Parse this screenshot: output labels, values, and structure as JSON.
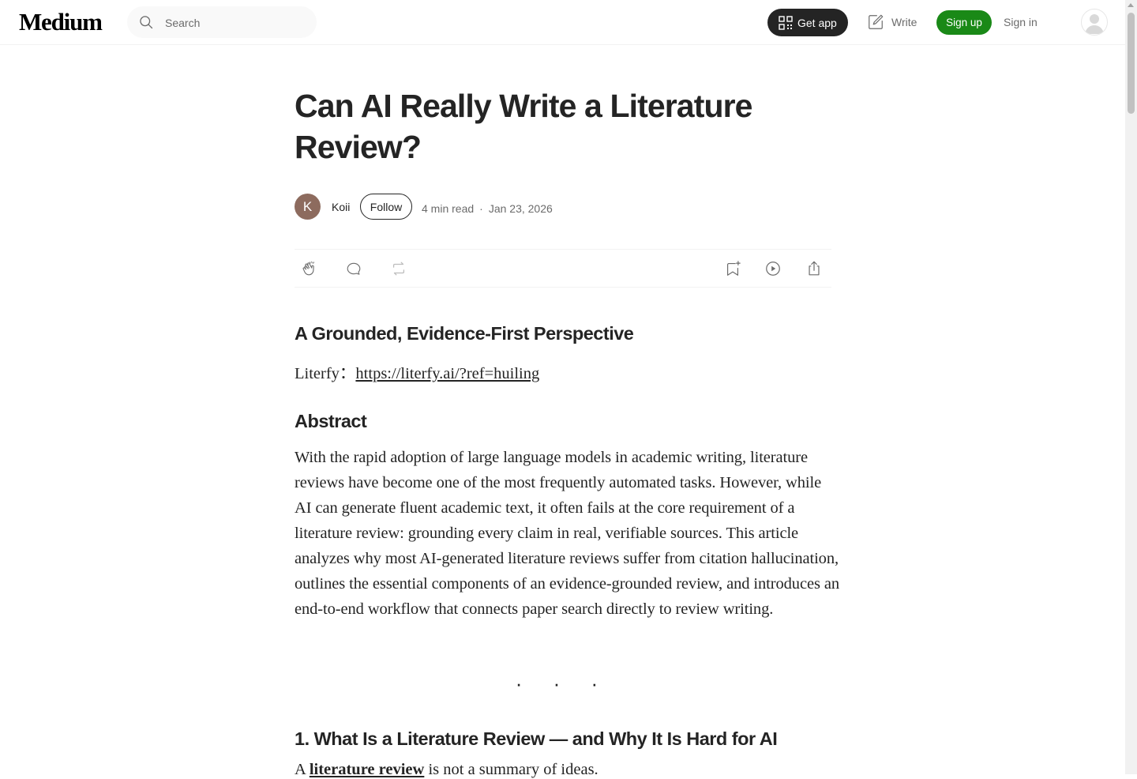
{
  "nav": {
    "logo": "Medium",
    "search_placeholder": "Search",
    "get_app": "Get app",
    "write": "Write",
    "sign_up": "Sign up",
    "sign_in": "Sign in"
  },
  "article": {
    "title": "Can AI Really Write a Literature Review?",
    "author_initial": "K",
    "author": "Koii",
    "follow": "Follow",
    "read_time": "4 min read",
    "date": "Jan 23, 2026",
    "subtitle": "A Grounded, Evidence-First Perspective",
    "ref_label": "Literfy：",
    "ref_link": "https://literfy.ai/?ref=huiling",
    "abstract_heading": "Abstract",
    "abstract_text": "With the rapid adoption of large language models in academic writing, literature reviews have become one of the most frequently automated tasks. However, while AI can generate fluent academic text, it often fails at the core requirement of a literature review: grounding every claim in real, verifiable sources. This article analyzes why most AI-generated literature reviews suffer from citation hallucination, outlines the essential components of an evidence-grounded review, and introduces an end-to-end workflow that connects paper search directly to review writing.",
    "separator": "...",
    "section1_heading": "1. What Is a Literature Review — and Why It Is Hard for AI",
    "section1_lead_prefix": "A ",
    "section1_lead_bold": "literature review",
    "section1_lead_rest": " is not a summary of ideas."
  },
  "actions": {
    "clap": "clap-icon",
    "comment": "comment-icon",
    "repost": "repost-icon",
    "bookmark": "bookmark-add-icon",
    "listen": "play-icon",
    "share": "share-icon"
  },
  "colors": {
    "brand_green": "#1a8917",
    "text": "#242424",
    "muted": "#6b6b6b",
    "dark_button": "#242424"
  }
}
